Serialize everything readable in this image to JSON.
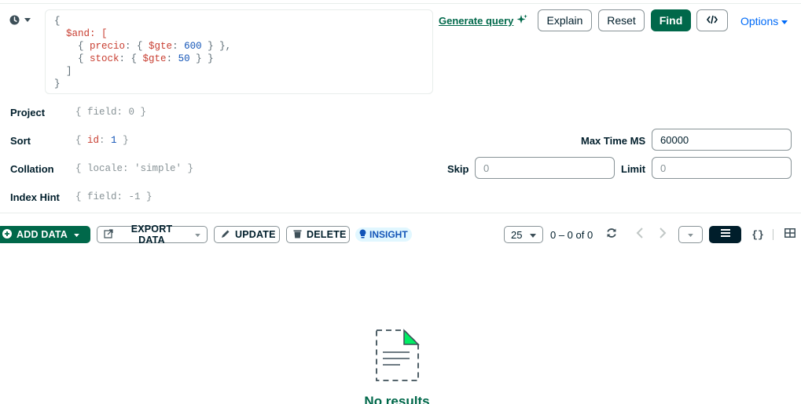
{
  "query": {
    "lines": [
      "{",
      "  $and: [",
      "    { precio: { $gte: 600 } },",
      "    { stock: { $gte: 50 } }",
      "  ]",
      "}"
    ]
  },
  "actions": {
    "generate_query": "Generate query",
    "explain": "Explain",
    "reset": "Reset",
    "find": "Find",
    "options": "Options"
  },
  "options": {
    "project": {
      "label": "Project",
      "value": "{ field: 0 }"
    },
    "sort": {
      "label": "Sort",
      "value": "{ id: 1 }"
    },
    "collation": {
      "label": "Collation",
      "value": "{ locale: 'simple' }"
    },
    "index_hint": {
      "label": "Index Hint",
      "value": "{ field: -1 }"
    },
    "max_time_ms": {
      "label": "Max Time MS",
      "value": "60000"
    },
    "skip": {
      "label": "Skip",
      "placeholder": "0"
    },
    "limit": {
      "label": "Limit",
      "placeholder": "0"
    }
  },
  "toolbar": {
    "add_data": "ADD DATA",
    "export_data": "EXPORT DATA",
    "update": "UPDATE",
    "delete": "DELETE",
    "insight": "INSIGHT",
    "page_size": "25",
    "range": "0 – 0 of 0",
    "icons": [
      "refresh-icon",
      "chevron-left-icon",
      "chevron-right-icon",
      "list-view-icon",
      "json-view-icon",
      "table-view-icon"
    ]
  },
  "empty_state": {
    "title": "No results"
  },
  "colors": {
    "primary_green": "#00684a",
    "link_blue": "#016bf8",
    "dark": "#001e2b",
    "insight_bg": "#e1f7ff"
  }
}
